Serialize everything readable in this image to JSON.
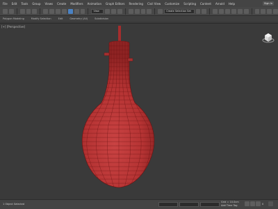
{
  "menu": {
    "items": [
      "File",
      "Edit",
      "Tools",
      "Group",
      "Views",
      "Create",
      "Modifiers",
      "Animation",
      "Graph Editors",
      "Rendering",
      "Civil View",
      "Customize",
      "Scripting",
      "Content",
      "Arnold",
      "Help"
    ],
    "signin_label": "Sign In"
  },
  "toolbar": {
    "view_dropdown": "View",
    "selection_set_dropdown": "Create Selection Set"
  },
  "ribbon": {
    "tabs": [
      "Polygon Modeling",
      "Modify Selection",
      "Edit",
      "Geometry (All)",
      "Subdivision"
    ]
  },
  "viewport": {
    "label": "[+] [Perspective]",
    "object_color": "#b83535",
    "wire_color": "#6a1212"
  },
  "status": {
    "object_count": "1 Object Selected",
    "grid_value": "Grid = 10.0cm",
    "add_time_tag": "Add Time Tag",
    "frame": "0"
  }
}
